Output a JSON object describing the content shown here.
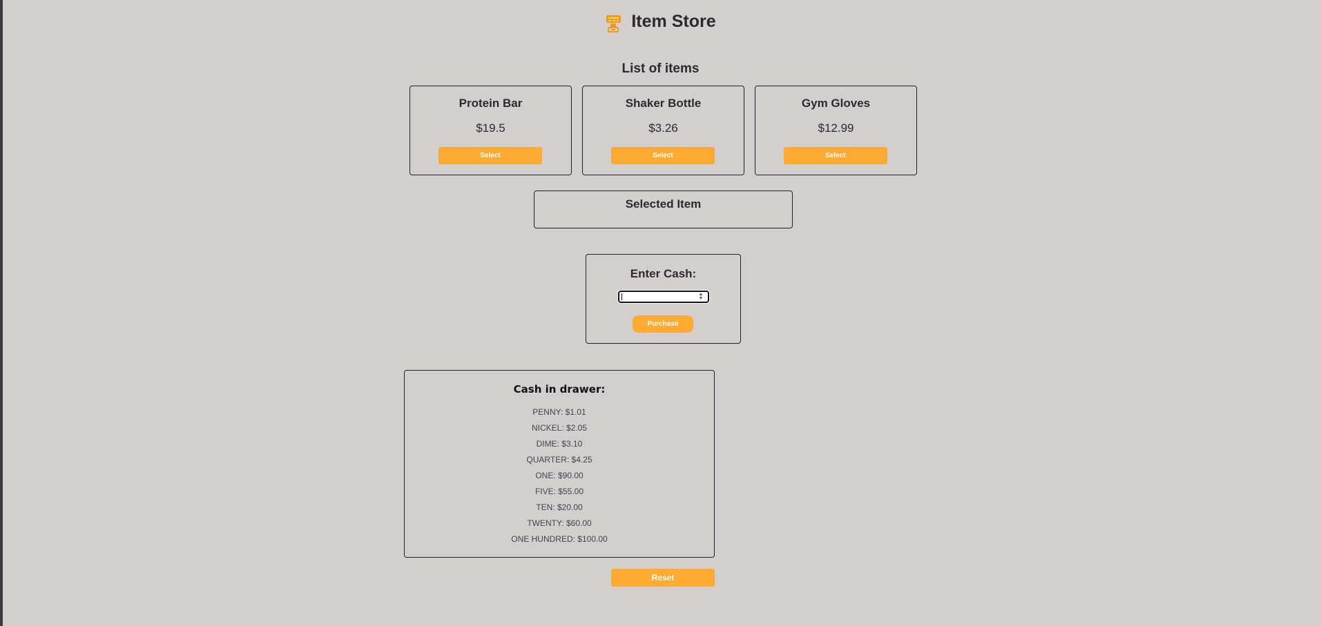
{
  "header": {
    "logo_icon": "cash-register-icon",
    "title": "Item Store"
  },
  "list": {
    "title": "List of items",
    "items": [
      {
        "name": "Protein Bar",
        "price": "$19.5",
        "button": "Select"
      },
      {
        "name": "Shaker Bottle",
        "price": "$3.26",
        "button": "Select"
      },
      {
        "name": "Gym Gloves",
        "price": "$12.99",
        "button": "Select"
      }
    ]
  },
  "selected": {
    "title": "Selected Item"
  },
  "cash": {
    "title": "Enter Cash:",
    "input_value": "",
    "purchase_label": "Purchase"
  },
  "drawer": {
    "title": "Cash in drawer:",
    "rows": [
      "PENNY: $1.01",
      "NICKEL: $2.05",
      "DIME: $3.10",
      "QUARTER: $4.25",
      "ONE: $90.00",
      "FIVE: $55.00",
      "TEN: $20.00",
      "TWENTY: $60.00",
      "ONE HUNDRED: $100.00"
    ]
  },
  "reset_label": "Reset",
  "colors": {
    "accent": "#fdab32",
    "background": "#d3cfcf"
  }
}
